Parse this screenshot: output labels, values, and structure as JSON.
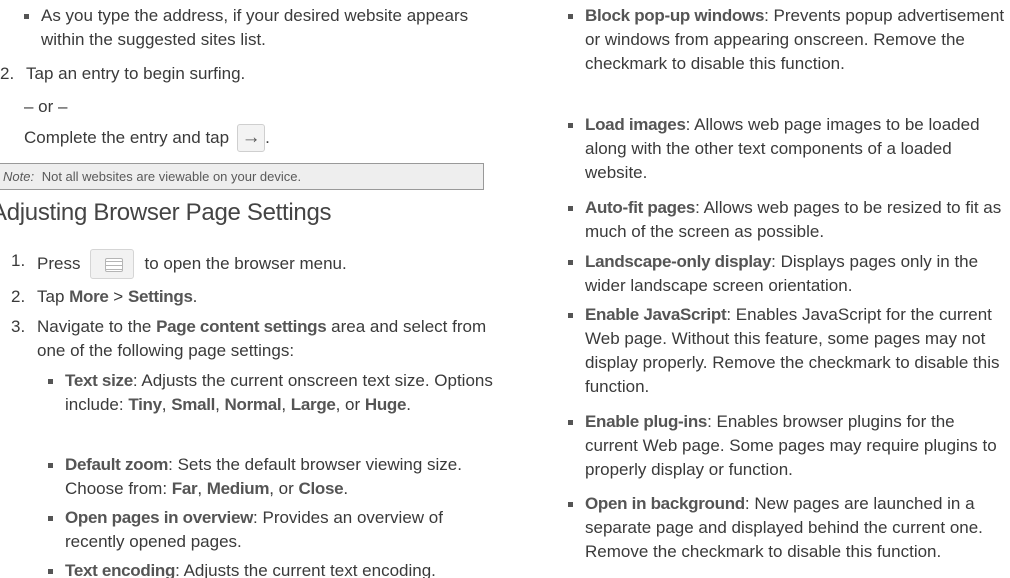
{
  "left": {
    "bullet_typing": "As you type the address, if your desired website appears within the suggested sites list.",
    "step2_num": "2.",
    "step2_text": "Tap an entry to begin surfing.",
    "or_text": "– or –",
    "complete_text": "Complete the entry and tap",
    "complete_end": ".",
    "arrow_icon": "→",
    "note_label": "Note:",
    "note_text": "Not all websites are viewable on your device.",
    "heading": "Adjusting Browser Page Settings",
    "step1_num": "1.",
    "step1_pre": "Press",
    "step1_post": "to open the browser menu.",
    "step2b_num": "2.",
    "step2b_pre": "Tap ",
    "step2b_more": "More",
    "step2b_sep": " > ",
    "step2b_settings": "Settings",
    "step2b_end": ".",
    "step3_num": "3.",
    "step3_pre": "Navigate to the ",
    "step3_bold": "Page content settings",
    "step3_post": " area and select from one of the following page settings:",
    "text_size_label": "Text size",
    "text_size_desc": ": Adjusts the current onscreen text size. Options include: ",
    "opt_tiny": "Tiny",
    "opt_small": "Small",
    "opt_normal": "Normal",
    "opt_large": "Large",
    "opt_huge": "Huge",
    "comma": ", ",
    "or_word": ", or ",
    "period": ".",
    "default_zoom_label": "Default zoom",
    "default_zoom_desc": ": Sets the default browser viewing size. Choose from: ",
    "opt_far": "Far",
    "opt_medium": "Medium",
    "opt_close": "Close",
    "overview_label": "Open pages in overview",
    "overview_desc": ": Provides an overview of recently opened pages.",
    "encoding_label": "Text encoding",
    "encoding_desc": ": Adjusts the current text encoding."
  },
  "right": {
    "items": [
      {
        "label": "Block pop-up windows",
        "desc": ": Prevents popup advertisement or windows from appearing onscreen. Remove the checkmark to disable this function."
      },
      {
        "label": "Load images",
        "desc": ": Allows web page images to be loaded along with the other text components of a loaded website."
      },
      {
        "label": "Auto-fit pages",
        "desc": ": Allows web pages to be resized to fit as much of the screen as possible."
      },
      {
        "label": "Landscape-only display",
        "desc": ": Displays pages only in the wider landscape screen orientation."
      },
      {
        "label": "Enable JavaScript",
        "desc": ": Enables JavaScript for the current Web page. Without this feature, some pages may not display properly. Remove the checkmark to disable this function."
      },
      {
        "label": "Enable plug-ins",
        "desc": ": Enables browser plugins for the current Web page. Some pages may require plugins to properly display or function."
      },
      {
        "label": "Open in background",
        "desc": ": New pages are launched in a separate page and displayed behind the current one. Remove the checkmark to disable this function."
      }
    ]
  }
}
